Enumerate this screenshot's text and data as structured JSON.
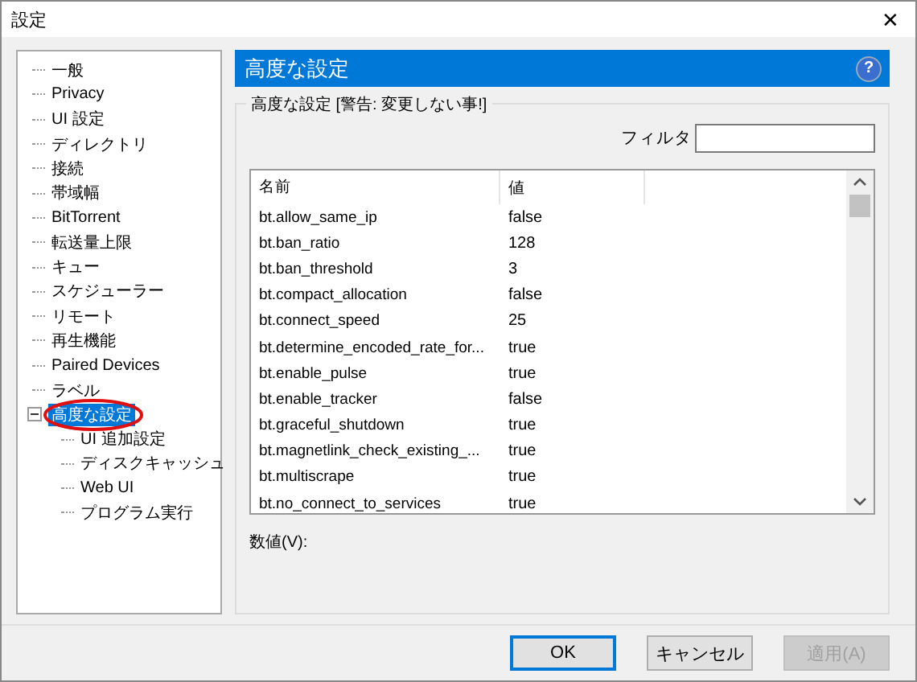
{
  "window": {
    "title": "設定",
    "close": "✕"
  },
  "sidebar": {
    "items": [
      {
        "label": "一般",
        "selected": false
      },
      {
        "label": "Privacy",
        "selected": false
      },
      {
        "label": "UI 設定",
        "selected": false
      },
      {
        "label": "ディレクトリ",
        "selected": false
      },
      {
        "label": "接続",
        "selected": false
      },
      {
        "label": "帯域幅",
        "selected": false
      },
      {
        "label": "BitTorrent",
        "selected": false
      },
      {
        "label": "転送量上限",
        "selected": false
      },
      {
        "label": "キュー",
        "selected": false
      },
      {
        "label": "スケジューラー",
        "selected": false
      },
      {
        "label": "リモート",
        "selected": false
      },
      {
        "label": "再生機能",
        "selected": false
      },
      {
        "label": "Paired Devices",
        "selected": false
      },
      {
        "label": "ラベル",
        "selected": false
      },
      {
        "label": "高度な設定",
        "selected": true,
        "circled": true,
        "expanded": true,
        "children": [
          {
            "label": "UI 追加設定",
            "selected": false
          },
          {
            "label": "ディスクキャッシュ",
            "selected": false
          },
          {
            "label": "Web UI",
            "selected": false
          },
          {
            "label": "プログラム実行",
            "selected": false
          }
        ]
      }
    ]
  },
  "panel": {
    "title": "高度な設定",
    "help": "?",
    "group_title": "高度な設定 [警告: 変更しない事!]",
    "filter_label": "フィルタ",
    "table": {
      "columns": [
        "名前",
        "値"
      ],
      "rows": [
        [
          "bt.allow_same_ip",
          "false"
        ],
        [
          "bt.ban_ratio",
          "128"
        ],
        [
          "bt.ban_threshold",
          "3"
        ],
        [
          "bt.compact_allocation",
          "false"
        ],
        [
          "bt.connect_speed",
          "25"
        ],
        [
          "bt.determine_encoded_rate_for...",
          "true"
        ],
        [
          "bt.enable_pulse",
          "true"
        ],
        [
          "bt.enable_tracker",
          "false"
        ],
        [
          "bt.graceful_shutdown",
          "true"
        ],
        [
          "bt.magnetlink_check_existing_...",
          "true"
        ],
        [
          "bt.multiscrape",
          "true"
        ],
        [
          "bt.no_connect_to_services",
          "true"
        ]
      ]
    },
    "value_label": "数値(V):"
  },
  "buttons": [
    {
      "label": "OK",
      "default": true,
      "disabled": false
    },
    {
      "label": "キャンセル",
      "default": false,
      "disabled": false
    },
    {
      "label": "適用(A)",
      "default": false,
      "disabled": true
    }
  ]
}
